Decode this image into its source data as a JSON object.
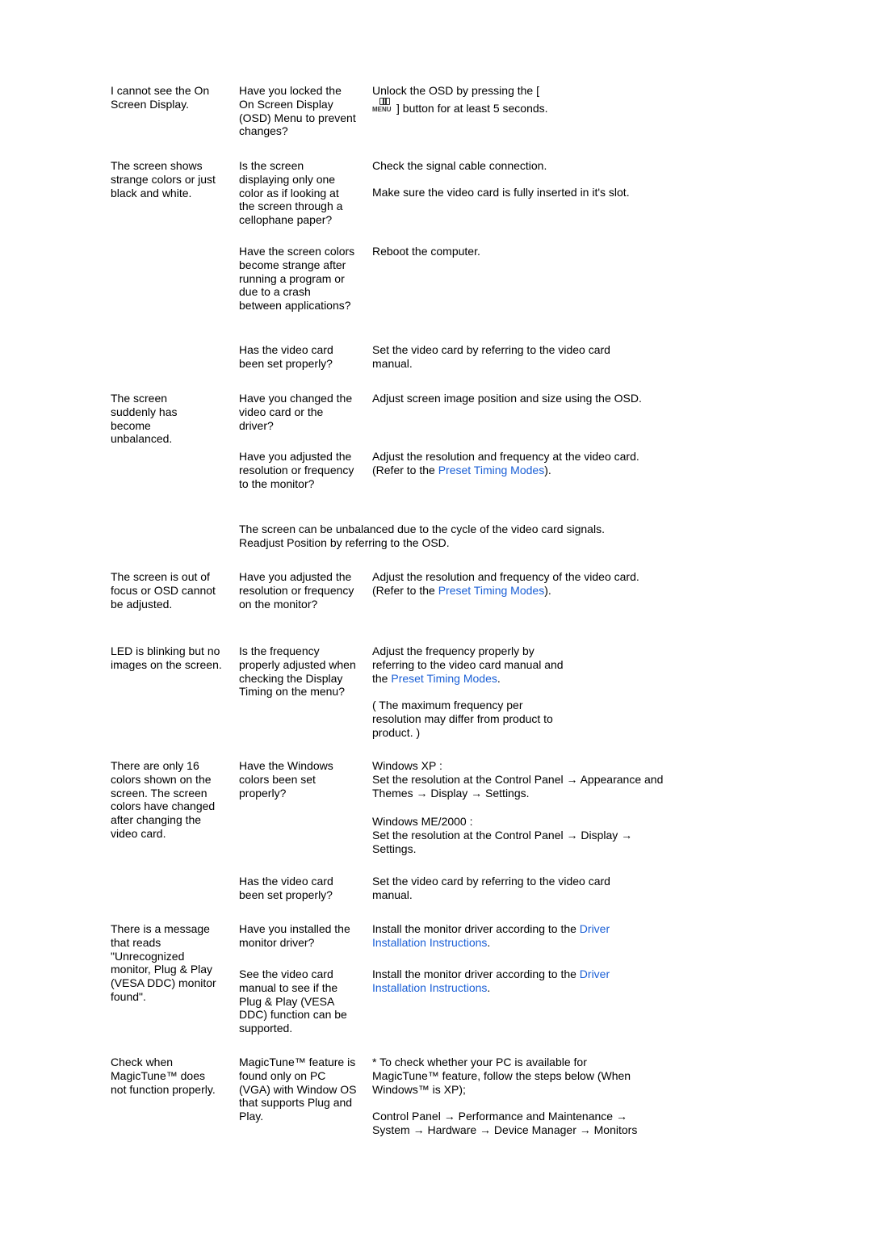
{
  "colors": {
    "text": "#000000",
    "link": "#1a5fd6",
    "background": "#ffffff"
  },
  "rows": [
    {
      "symptom": "I cannot see the On Screen Display.",
      "check": "Have you locked the On Screen Display (OSD) Menu to prevent changes?",
      "solution_pre": "Unlock the OSD by pressing the [",
      "solution_icon": "menu-button-icon",
      "solution_icon_label": "MENU",
      "solution_post": "] button for at least 5 seconds."
    },
    {
      "symptom": "The screen shows strange colors or just black and white.",
      "check": "Is the screen displaying only one color as if looking at the screen through a cellophane paper?",
      "solution_1": "Check the signal cable connection.",
      "solution_2": "Make sure the video card is fully inserted in it's slot."
    },
    {
      "check": "Have the screen colors become strange after running a program or due to a crash between applications?",
      "solution": "Reboot the computer."
    },
    {
      "check": "Has the video card been set properly?",
      "solution": "Set the video card by referring to the video card manual."
    },
    {
      "symptom": "The screen suddenly has become unbalanced.",
      "check": "Have you changed the video card or the driver?",
      "solution": "Adjust screen image position and size using the OSD."
    },
    {
      "check": "Have you adjusted the resolution or frequency to the monitor?",
      "solution_1": "Adjust the resolution and frequency at the video card.",
      "solution_2_pre": "(Refer to the ",
      "solution_2_link": "Preset Timing Modes",
      "solution_2_post": ")."
    },
    {
      "note": "The screen can be unbalanced due to the cycle of the video card signals. Readjust Position by referring to the OSD."
    },
    {
      "symptom": "The screen is out of focus or OSD cannot be adjusted.",
      "check": "Have you adjusted the resolution or frequency on the monitor?",
      "solution_1": "Adjust the resolution and frequency of the video card.",
      "solution_2_pre": "(Refer to the ",
      "solution_2_link": "Preset Timing Modes",
      "solution_2_post": ")."
    },
    {
      "symptom": "LED is blinking but no images on the screen.",
      "check": "Is the frequency properly adjusted when checking the Display Timing on the menu?",
      "solution_pre": "Adjust the frequency properly by referring to the video card manual and the ",
      "solution_link": "Preset Timing Modes",
      "solution_post": ".",
      "solution_note": "( The maximum frequency per resolution may differ from product to product. )"
    },
    {
      "symptom": "There are only 16 colors shown on the screen. The screen colors have changed after changing the video card.",
      "check": "Have the Windows colors been set properly?",
      "xp_title": "Windows XP :",
      "xp_text": "Set the resolution at the Control Panel → Appearance and Themes → Display → Settings.",
      "me_title": "Windows ME/2000 :",
      "me_text": "Set the resolution at the Control Panel → Display → Settings."
    },
    {
      "check": "Has the video card been set properly?",
      "solution": "Set the video card by referring to the video card manual."
    },
    {
      "symptom": "There is a message that reads \"Unrecognized monitor, Plug & Play (VESA DDC) monitor found\".",
      "check": "Have you installed the monitor driver?",
      "solution_pre": "Install the monitor driver according to the ",
      "solution_link": "Driver Installation Instructions",
      "solution_post": "."
    },
    {
      "check": "See the video card manual to see if the Plug & Play (VESA DDC) function can be supported.",
      "solution_pre": "Install the monitor driver according to the ",
      "solution_link": "Driver Installation Instructions",
      "solution_post": "."
    },
    {
      "symptom": "Check when MagicTune™ does not function properly.",
      "check": "MagicTune™ feature is found only on PC (VGA) with Window OS that supports Plug and Play.",
      "solution_1": "* To check whether your PC is available for MagicTune™ feature, follow the steps below (When Windows™ is XP);",
      "solution_2": "Control Panel → Performance and Maintenance → System → Hardware → Device Manager → Monitors"
    }
  ]
}
